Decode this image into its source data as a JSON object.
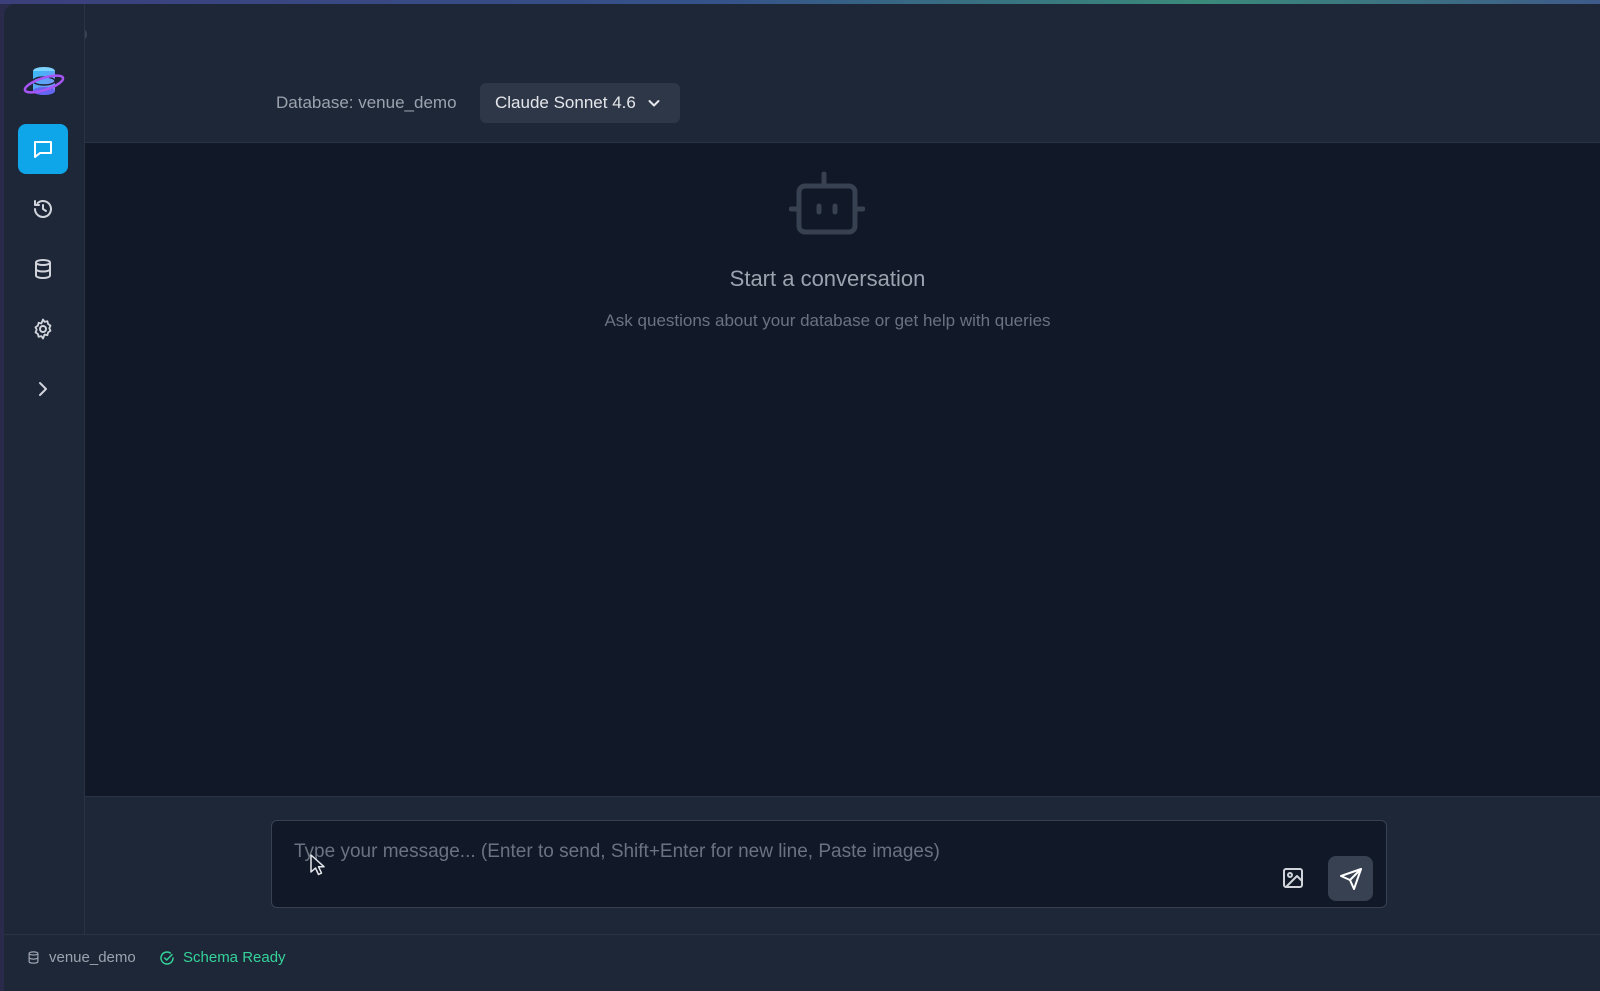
{
  "header": {
    "database_label": "Database: venue_demo",
    "model_selected": "Claude Sonnet 4.6"
  },
  "sidebar": {
    "items": [
      {
        "name": "chat",
        "icon": "chat-icon",
        "active": true
      },
      {
        "name": "history",
        "icon": "history-icon",
        "active": false
      },
      {
        "name": "database",
        "icon": "database-icon",
        "active": false
      },
      {
        "name": "settings",
        "icon": "gear-icon",
        "active": false
      },
      {
        "name": "expand",
        "icon": "chevron-right-icon",
        "active": false
      }
    ]
  },
  "empty_state": {
    "title": "Start a conversation",
    "subtitle": "Ask questions about your database or get help with queries"
  },
  "composer": {
    "placeholder": "Type your message... (Enter to send, Shift+Enter for new line, Paste images)",
    "value": ""
  },
  "statusbar": {
    "database": "venue_demo",
    "schema_status": "Schema Ready"
  },
  "colors": {
    "accent": "#0ea5e9",
    "success": "#34d399",
    "background": "#111827",
    "panel": "#1e2738"
  }
}
